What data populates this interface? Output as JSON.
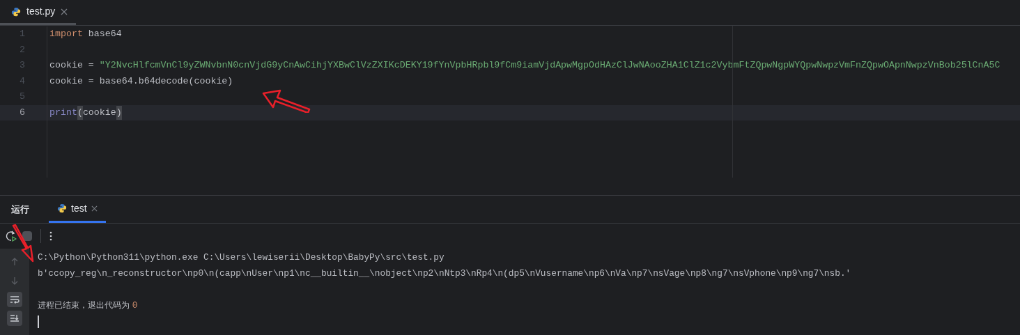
{
  "editor_tabs": [
    {
      "label": "test.py",
      "selected": true
    }
  ],
  "code_lines": [
    {
      "number": "1",
      "current": false,
      "tokens": [
        {
          "kind": "keyword",
          "text": "import"
        },
        {
          "kind": "plain",
          "text": " base64"
        }
      ]
    },
    {
      "number": "2",
      "current": false
    },
    {
      "number": "3",
      "current": false,
      "tokens": [
        {
          "kind": "plain",
          "text": "cookie = "
        },
        {
          "kind": "string",
          "text": "\"Y2NvcHlfcmVnCl9yZWNvbnN0cnVjdG9yCnAwCihjYXBwClVzZXIKcDEKY19fYnVpbHRpbl9fCm9iamVjdApwMgpOdHAzClJwNAooZHA1ClZ1c2VybmFtZQpwNgpWYQpwNwpzVmFnZQpwOApnNwpzVnBob25lCnA5C"
        }
      ]
    },
    {
      "number": "4",
      "current": false,
      "tokens": [
        {
          "kind": "plain",
          "text": "cookie = base64.b64decode(cookie)"
        }
      ]
    },
    {
      "number": "5",
      "current": false
    },
    {
      "number": "6",
      "current": true,
      "tokens": [
        {
          "kind": "builtin",
          "text": "print"
        },
        {
          "kind": "paren_match",
          "text": "("
        },
        {
          "kind": "plain",
          "text": "cookie"
        },
        {
          "kind": "paren_match",
          "text": ")"
        }
      ]
    }
  ],
  "run_panel": {
    "title": "运行",
    "tabs": [
      {
        "label": "test",
        "selected": true
      }
    ],
    "side_tools": [
      {
        "kind": "up",
        "on": false
      },
      {
        "kind": "down",
        "on": false
      },
      {
        "kind": "wrap",
        "on": true
      },
      {
        "kind": "scroll_end",
        "on": true
      }
    ],
    "output": [
      {
        "kind": "command",
        "text": "C:\\Python\\Python311\\python.exe C:\\Users\\lewiserii\\Desktop\\BabyPy\\src\\test.py"
      },
      {
        "kind": "output",
        "text": "b'ccopy_reg\\n_reconstructor\\np0\\n(capp\\nUser\\np1\\nc__builtin__\\nobject\\np2\\nNtp3\\nRp4\\n(dp5\\nVusername\\np6\\nVa\\np7\\nsVage\\np8\\ng7\\nsVphone\\np9\\ng7\\nsb.'"
      },
      {
        "kind": "blank"
      },
      {
        "kind": "exit",
        "text": "进程已结束，退出代码为 ",
        "code": "0"
      },
      {
        "kind": "cursor"
      }
    ]
  }
}
